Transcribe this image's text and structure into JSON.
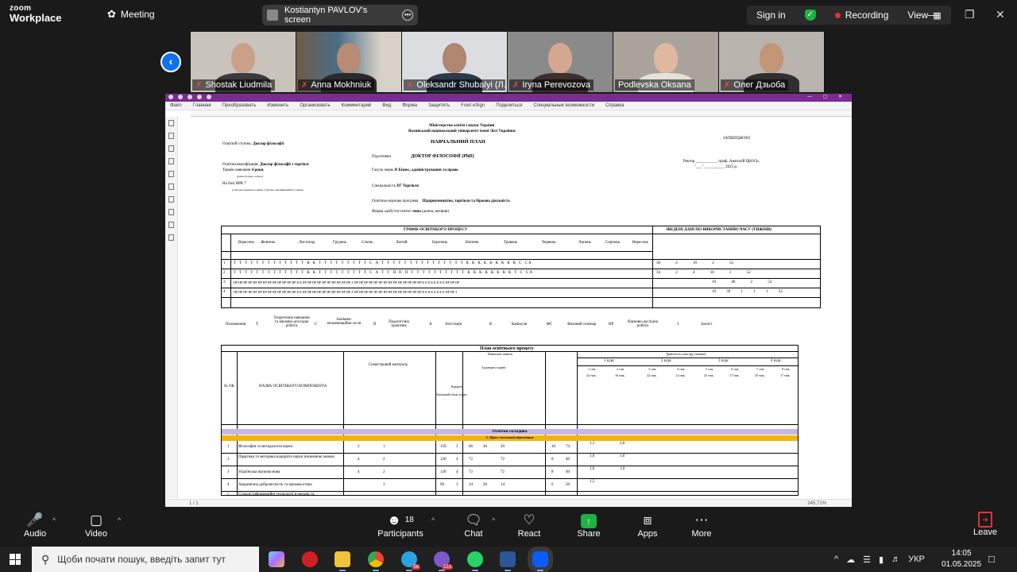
{
  "app": {
    "brand_line1": "zoom",
    "brand_line2": "Workplace",
    "meeting_label": "Meeting",
    "screen_share_label": "Kostiantyn PAVLOV's screen",
    "sign_in": "Sign in",
    "recording": "Recording",
    "view": "View"
  },
  "participants": [
    {
      "name": "Shostak Liudmila",
      "muted": true
    },
    {
      "name": "Anna Mokhniuk",
      "muted": true
    },
    {
      "name": "Oleksandr Shubalyi (Л...",
      "muted": true
    },
    {
      "name": "Iryna Perevozova",
      "muted": true
    },
    {
      "name": "Podlevska Oksana",
      "muted": false
    },
    {
      "name": "Олег Дзьоба",
      "muted": true
    }
  ],
  "foxit": {
    "menu": [
      "Файл",
      "Главная",
      "Преобразовать",
      "Изменить",
      "Организовать",
      "Комментарий",
      "Вид",
      "Форма",
      "Защитить",
      "Foxit eSign",
      "Поделиться",
      "Специальные возможности",
      "Справка"
    ],
    "page_indicator": "1 / 1",
    "zoom": "245,71%"
  },
  "document": {
    "ministry": "Міністерство освіти і науки України",
    "university": "Волинський національний університет імені Лесі Українки",
    "title": "НАВЧАЛЬНИЙ ПЛАН",
    "approve": "ЗАТВЕРДЖУЮ",
    "rector": "Ректор ___________ проф. Анатолій ЦЬОСЬ",
    "rector_date": "\"___\" __________ 2025 р.",
    "level_label": "Освітній ступінь:",
    "level_value": "Доктор філософії",
    "preparation_label": "Підготовки",
    "preparation_value": "ДОКТОР ФІЛОСОФІЇ (PhD)",
    "qualification_label": "Освітня кваліфікація:",
    "qualification_value": "Доктор філософії з торгівлі",
    "term_label": "Термін навчання",
    "term_value": "4 роки",
    "term_note": "(денна форма, заочна)",
    "nrk_label": "На базі НРК 7",
    "nrk_note": "(освітньо-наукового рівня, освітньо-кваліфікаційного рівня)",
    "field_label": "Галузь знань",
    "field_value": "D Бізнес, адміністрування та право",
    "specialty_label": "Спеціальність",
    "specialty_value": "D7 Торгівля",
    "program_label": "Освітньо-наукова програма",
    "program_value": "Підприємництво, торгівля та біржова діяльність",
    "form_label": "Форма здобуття освіти:",
    "form_value": "очна",
    "form_note": "(денна, вечірня)",
    "schedule_title": "ГРАФІК ОСВІТНЬОГО ПРОЦЕСУ",
    "summary_title": "ЗВЕДЕНІ ДАНІ ПО ВИКОРИСТАННЮ ЧАСУ (ТИЖНІВ)",
    "months": [
      "Вересень",
      "Жовтень",
      "Листопад",
      "Грудень",
      "Січень",
      "Лютий",
      "Березень",
      "Квітень",
      "Травень",
      "Червень",
      "Липень",
      "Серпень",
      "Вересень"
    ],
    "course_rows": [
      {
        "course": "1",
        "cells": "Т Т Т Т Т Т Т Т Т Т Т Т Т К К Т Т Т Т Т Т Т Т Т С А Т Т Т Т Т Т Т Т Т Т Т Т Т Т Т К К К К К К К К К С СА",
        "summary": [
          "30",
          "2",
          "",
          "10",
          "",
          "2",
          "",
          "",
          "52"
        ]
      },
      {
        "course": "2",
        "cells": "Т Т Т Т Т Т Т Т Т Т Т Т Т К К Т Т Т Т Т Т Т Т Т С А Т Т П П П Т Т Т Т Т Т Т Т Т Т К К К К К К К К Т С СА",
        "summary": [
          "34",
          "2",
          "4",
          "10",
          "",
          "2",
          "",
          "",
          "52"
        ]
      },
      {
        "course": "3",
        "cells": "НР НР НР НР НР НР НР НР НР НР НР НР НР К К НР НР НР НР НР НР НР НР НР НР А НР НР НР НР НР НР НР НР НР НР НР НР НР НР К К К К К К К К НР НР НР",
        "summary": [
          "",
          "",
          "",
          "10",
          "40",
          "2",
          "",
          "",
          "52"
        ]
      },
      {
        "course": "4",
        "cells": "НР НР НР НР НР НР НР НР НР НР НР НР НР К К НР НР НР НР НР НР НР НР НР НР А НР НР НР НР НР НР НР НР НР НР НР НР НР НР К К К К К К К К НР НР З",
        "summary": [
          "",
          "",
          "",
          "10",
          "39",
          "1",
          "1",
          "1",
          "52"
        ]
      }
    ],
    "summary_cols": [
      "Теоретичне навчання та науково-дослідна робота",
      "Педагогічний семінар",
      "Педагогічна практика",
      "Канікули",
      "Науково-дослідна робота",
      "Атестація",
      "Фаховий семінар",
      "Захист",
      "Разом"
    ],
    "legend": [
      {
        "label": "Позначення"
      },
      {
        "code": "Т",
        "label": "Теоретичне навчання та науково-дослідна робота"
      },
      {
        "code": "С",
        "label": "Заліково-екзаменаційна сесія"
      },
      {
        "code": "П",
        "label": "Педагогічна практика"
      },
      {
        "code": "А",
        "label": "Атестація"
      },
      {
        "code": "К",
        "label": "Канікули"
      },
      {
        "code": "ФС",
        "label": "Фаховий семінар"
      },
      {
        "code": "НР",
        "label": "Науково-дослідна робота"
      },
      {
        "code": "З",
        "label": "Захист"
      }
    ],
    "plan_title": "План освітнього процесу",
    "plan_headers": {
      "num": "№ ОК",
      "name": "НАЗВА ОСВІТНЬОГО КОМПОНЕНТА",
      "control": "Семестровий контроль",
      "hours": "Загальний обсяг годин",
      "credits": "Кредити",
      "classes": "Навчальні заняття",
      "auditory": "Аудиторні години",
      "distribution": "Тривалість семестру (тижнів)"
    },
    "courses_heads": [
      "1 курс",
      "2 курс",
      "3 курс",
      "4 курс"
    ],
    "sem_heads": [
      "1 сем.",
      "2 сем.",
      "3 сем.",
      "4 сем.",
      "5 сем.",
      "6 сем.",
      "7 сем.",
      "8 сем."
    ],
    "weeks_heads": [
      "22 тиж.",
      "16 тиж.",
      "22 тиж.",
      "12 тиж.",
      "23 тиж.",
      "17 тиж.",
      "25 тиж.",
      "17 тиж."
    ],
    "band_main": "Освітня складова",
    "band_cycle": "1. Цикл загальної підготовки",
    "rows": [
      {
        "n": "1",
        "name": "Філософія та методологія науки",
        "exam": "2",
        "credit": "1",
        "hours": "150",
        "cr": "5",
        "aud": "66",
        "lec": "46",
        "sem": "20",
        "ind": "10",
        "self": "74",
        "d1": "1,5",
        "d2": "2,0"
      },
      {
        "n": "2",
        "name": "Практика та методика відкритої науки іноземною мовою",
        "exam": "4",
        "credit": "2",
        "hours": "120",
        "cr": "4",
        "aud": "72",
        "lec": "",
        "sem": "72",
        "ind": "8",
        "self": "40",
        "d1": "1,0",
        "d2": "1,0"
      },
      {
        "n": "3",
        "name": "Українська наукова мова",
        "exam": "4",
        "credit": "2",
        "hours": "120",
        "cr": "4",
        "aud": "72",
        "lec": "",
        "sem": "72",
        "ind": "8",
        "self": "40",
        "d1": "1,0",
        "d2": "1,0"
      },
      {
        "n": "4",
        "name": "Академічна доброчесність та наукова етика",
        "exam": "",
        "credit": "1",
        "hours": "90",
        "cr": "3",
        "aud": "34",
        "lec": "20",
        "sem": "14",
        "ind": "6",
        "self": "50",
        "d1": "1,5",
        "d2": ""
      },
      {
        "n": "5",
        "name": "Сучасні інформаційні технології в наукові та",
        "exam": "",
        "credit": "1",
        "hours": "90",
        "cr": "3",
        "aud": "34",
        "lec": "20",
        "sem": "14",
        "ind": "6",
        "self": "50",
        "d1": "1,5",
        "d2": ""
      }
    ]
  },
  "controls": {
    "audio": "Audio",
    "video": "Video",
    "participants": "Participants",
    "participants_count": "18",
    "chat": "Chat",
    "react": "React",
    "share": "Share",
    "apps": "Apps",
    "more": "More",
    "leave": "Leave"
  },
  "taskbar": {
    "search_placeholder": "Щоби почати пошук, введіть запит тут",
    "telegram_badge": "58",
    "viber_badge": "123",
    "language": "УКР",
    "time": "14:05",
    "date": "01.05.2025"
  }
}
